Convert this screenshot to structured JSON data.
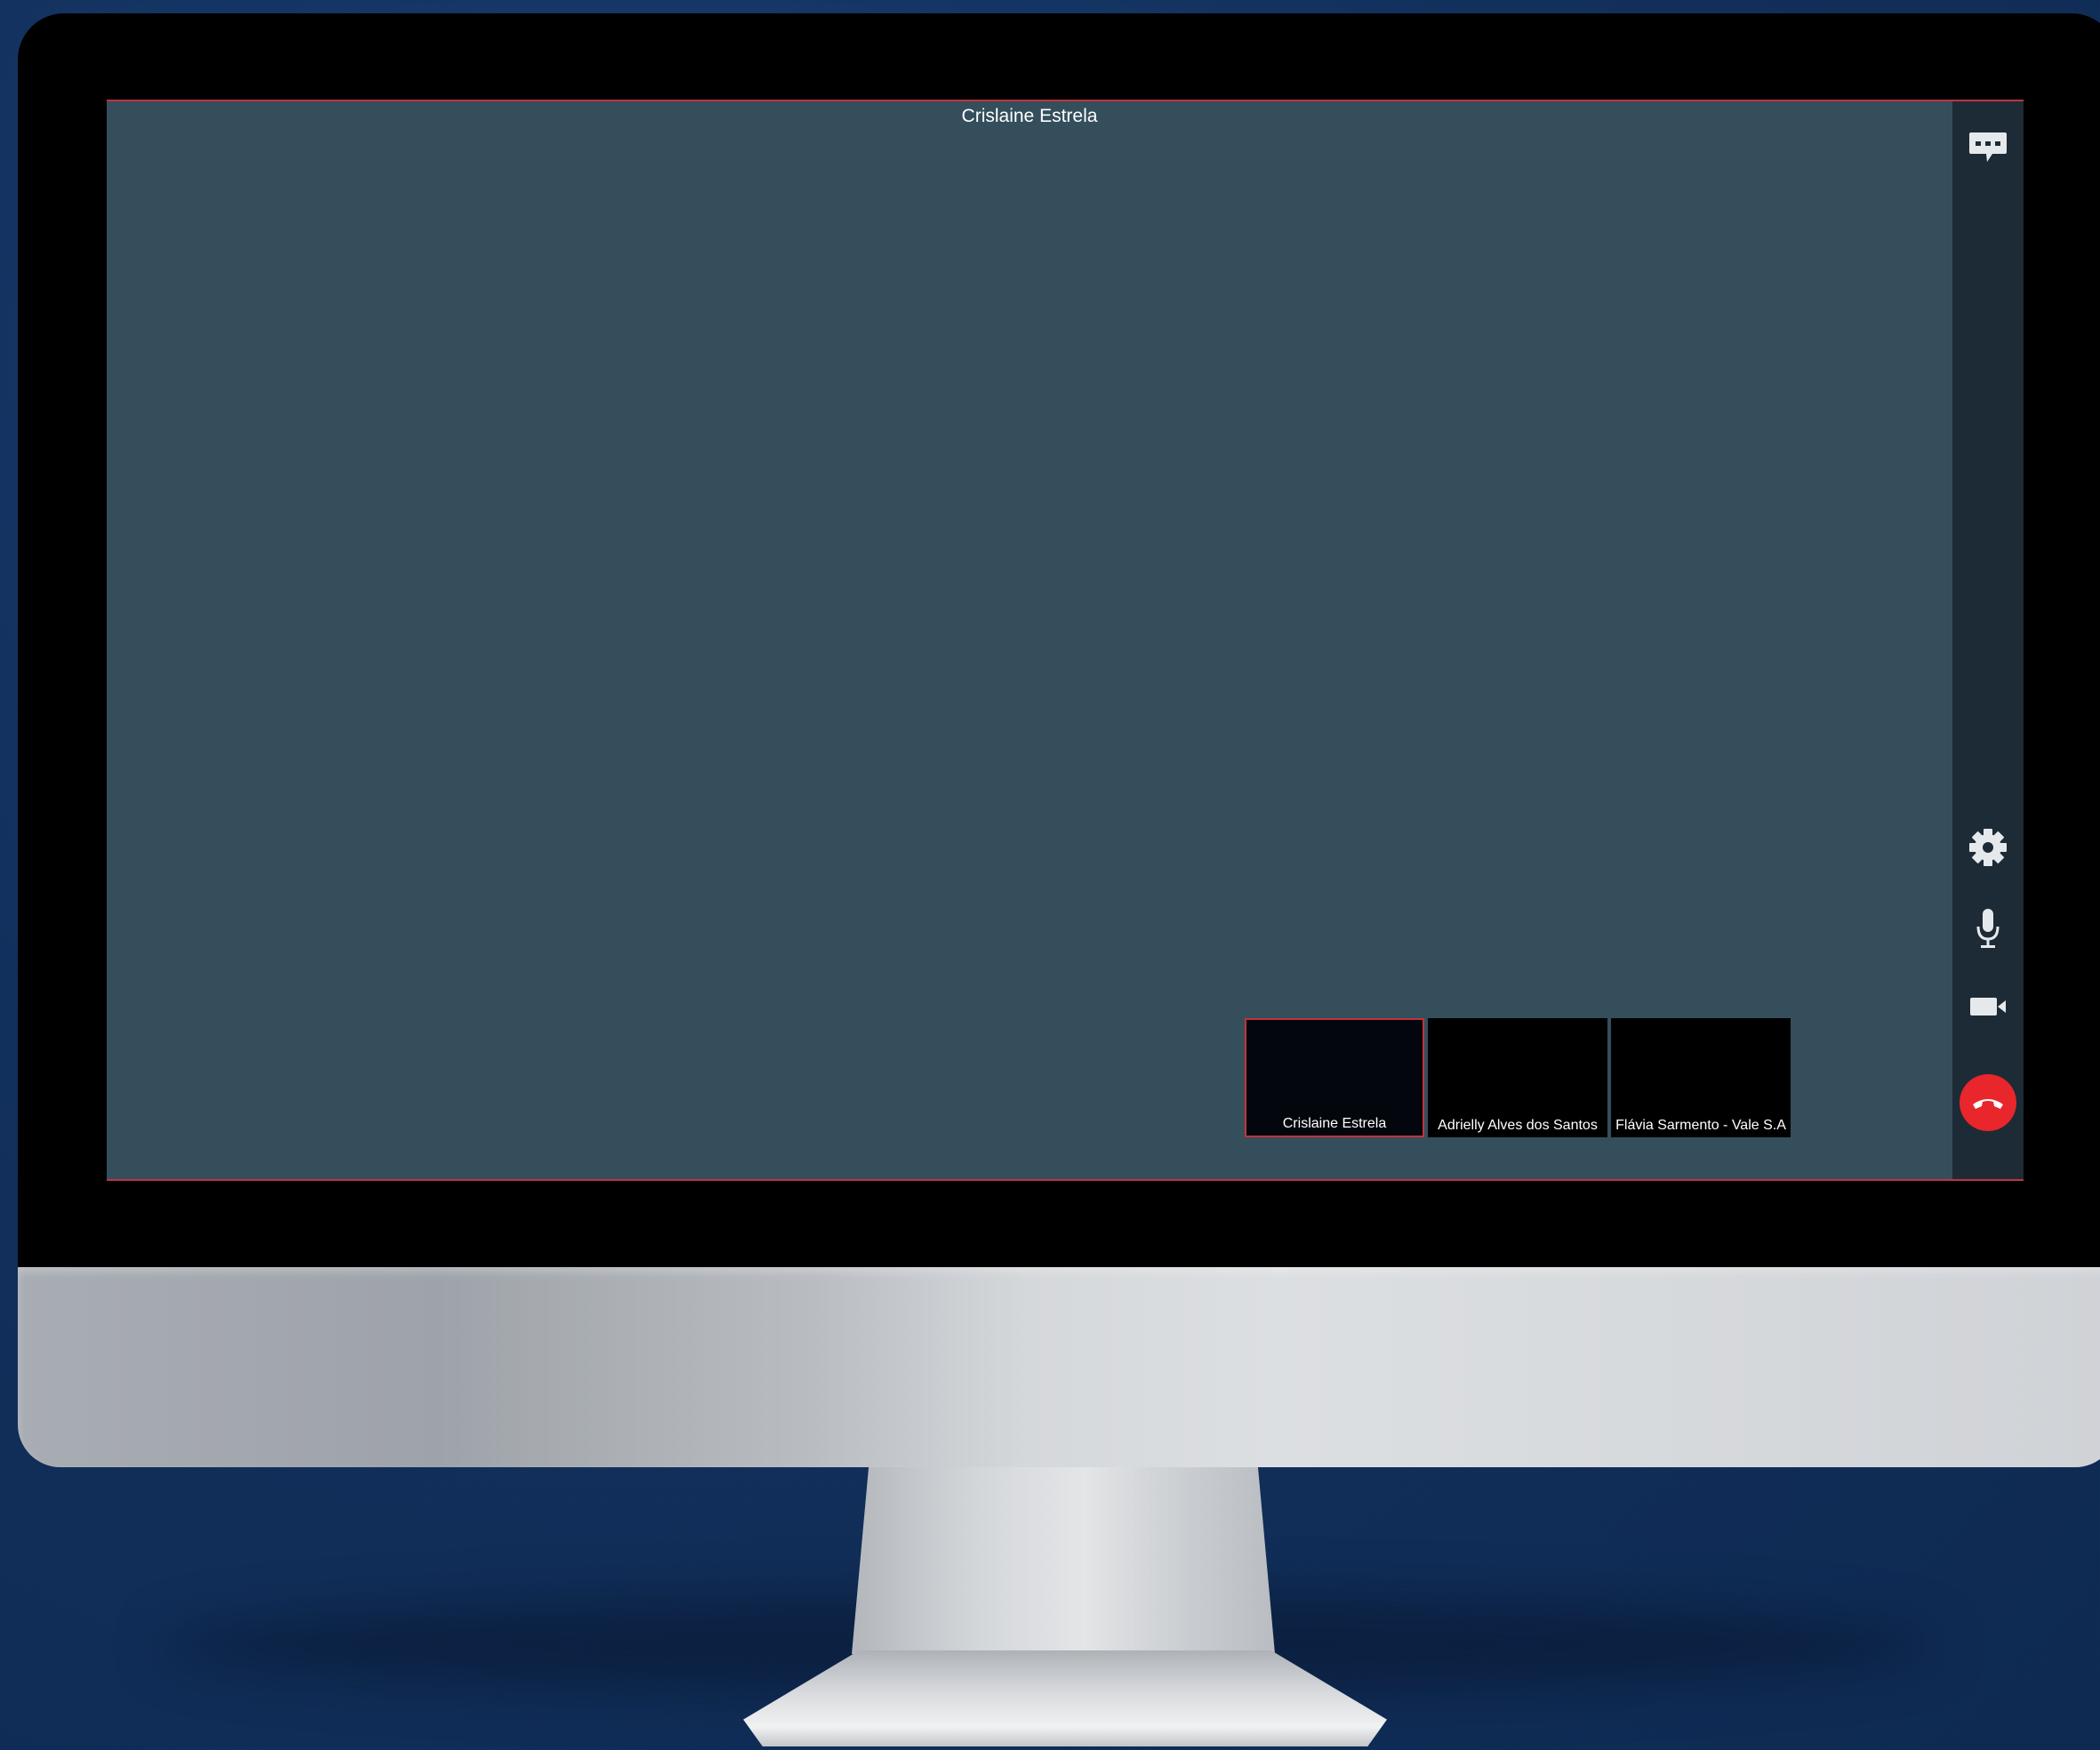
{
  "window": {
    "speaker_name": "Crislaine Estrela"
  },
  "participants": [
    {
      "name": "Crislaine Estrela",
      "active": true
    },
    {
      "name": "Adrielly Alves dos Santos",
      "active": false
    },
    {
      "name": "Flávia Sarmento - Vale S.A",
      "active": false
    }
  ],
  "toolbar": {
    "icons": [
      "chat-icon",
      "gear-icon",
      "microphone-icon",
      "camera-icon",
      "hang-up-icon"
    ]
  },
  "colors": {
    "background": "#12305c",
    "screen": "#344e5c",
    "toolbar": "#1d2b36",
    "accent_border": "#c0343d",
    "hang_up": "#e8262c",
    "icon": "#e6e9ec"
  }
}
